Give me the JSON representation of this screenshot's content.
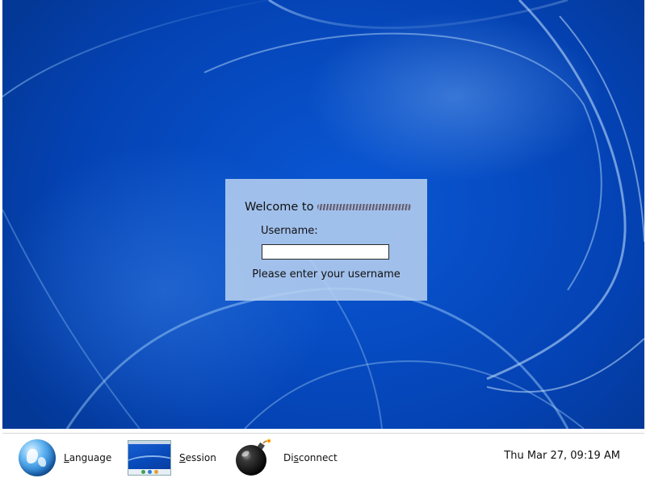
{
  "login": {
    "welcome_prefix": "Welcome to",
    "username_label": "Username:",
    "username_value": "",
    "prompt": "Please enter your username"
  },
  "taskbar": {
    "language": {
      "mnemonic": "L",
      "rest": "anguage",
      "icon": "globe-icon"
    },
    "session": {
      "mnemonic": "S",
      "rest": "ession",
      "icon": "session-preview-icon"
    },
    "disconnect": {
      "prefix": "Di",
      "mnemonic": "s",
      "rest": "connect",
      "icon": "bomb-icon"
    },
    "clock": "Thu Mar 27, 09:19 AM"
  },
  "colors": {
    "desktop_blue": "#0548c0",
    "panel": "#b9d2f0",
    "taskbar": "#ffffff"
  }
}
